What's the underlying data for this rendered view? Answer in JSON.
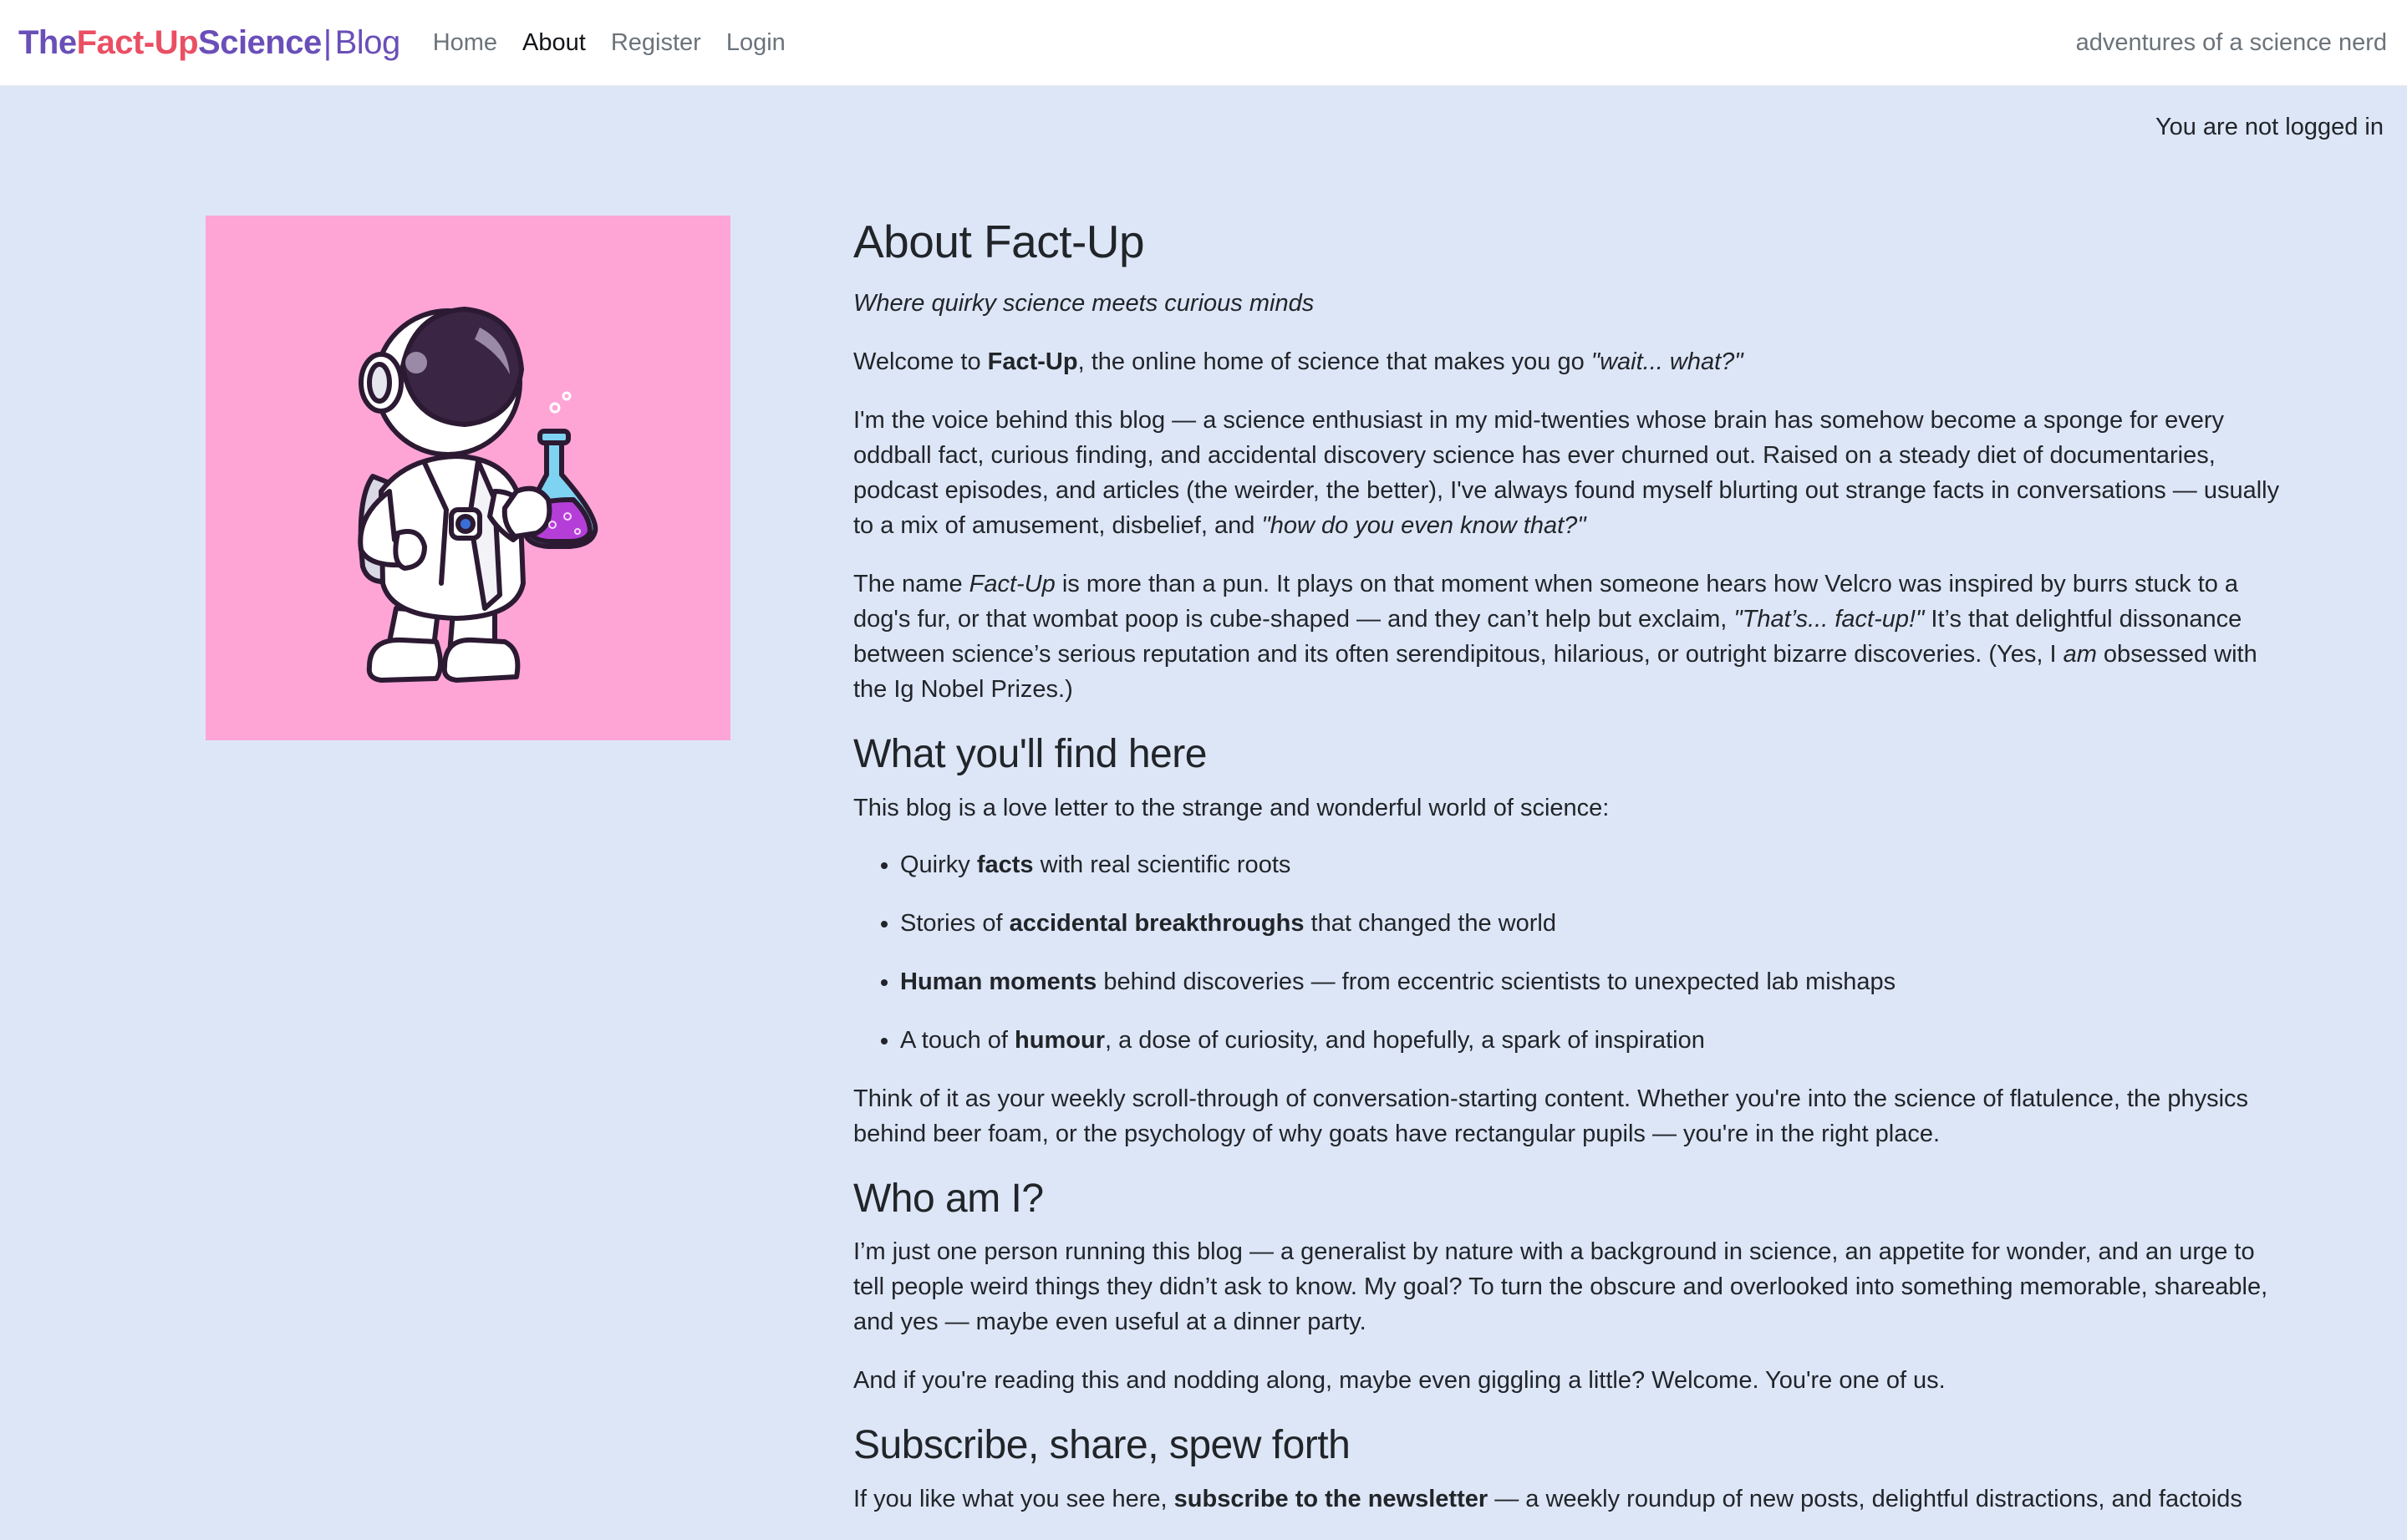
{
  "nav": {
    "brand": {
      "the": "The",
      "fact_up": "Fact-Up",
      "science": "Science",
      "separator": "|",
      "blog": "Blog"
    },
    "links": [
      "Home",
      "About",
      "Register",
      "Login"
    ],
    "active": "About",
    "tagline": "adventures of a science nerd"
  },
  "login_status": "You are not logged in",
  "hero_image": {
    "icon": "astronaut-scientist-icon",
    "background": "#fea5d6"
  },
  "colors": {
    "page_background": "#dde6f7",
    "brand_purple": "#6a4fb8",
    "brand_red": "#ea4f63"
  },
  "about": {
    "title": "About Fact-Up",
    "subtitle": "Where quirky science meets curious minds",
    "welcome": {
      "prefix": "Welcome to ",
      "name": "Fact-Up",
      "middle": ", the online home of science that makes you go ",
      "quote": "\"wait... what?\""
    },
    "intro": {
      "text": "I'm the voice behind this blog — a science enthusiast in my mid-twenties whose brain has somehow become a sponge for every oddball fact, curious finding, and accidental discovery science has ever churned out. Raised on a steady diet of documentaries, podcast episodes, and articles (the weirder, the better), I've always found myself blurting out strange facts in conversations — usually to a mix of amusement, disbelief, and ",
      "quote": "\"how do you even know that?\""
    },
    "name_para": {
      "p1": "The name ",
      "name": "Fact-Up",
      "p2": " is more than a pun. It plays on that moment when someone hears how Velcro was inspired by burrs stuck to a dog's fur, or that wombat poop is cube-shaped — and they can’t help but exclaim, ",
      "quote": "\"That’s... fact-up!\"",
      "p3": " It’s that delightful dissonance between science’s serious reputation and its often serendipitous, hilarious, or outright bizarre discoveries. (Yes, I ",
      "am": "am",
      "p4": " obsessed with the Ig Nobel Prizes.)"
    }
  },
  "find": {
    "heading": "What you'll find here",
    "intro": "This blog is a love letter to the strange and wonderful world of science:",
    "items": [
      {
        "pre": "Quirky ",
        "bold": "facts",
        "post": " with real scientific roots"
      },
      {
        "pre": "Stories of ",
        "bold": "accidental breakthroughs",
        "post": " that changed the world"
      },
      {
        "pre": "",
        "bold": "Human moments",
        "post": " behind discoveries — from eccentric scientists to unexpected lab mishaps"
      },
      {
        "pre": "A touch of ",
        "bold": "humour",
        "post": ", a dose of curiosity, and hopefully, a spark of inspiration"
      }
    ],
    "outro": "Think of it as your weekly scroll-through of conversation-starting content. Whether you're into the science of flatulence, the physics behind beer foam, or the psychology of why goats have rectangular pupils — you're in the right place."
  },
  "who": {
    "heading": "Who am I?",
    "p1": "I’m just one person running this blog — a generalist by nature with a background in science, an appetite for wonder, and an urge to tell people weird things they didn’t ask to know. My goal? To turn the obscure and overlooked into something memorable, shareable, and yes — maybe even useful at a dinner party.",
    "p2": "And if you're reading this and nodding along, maybe even giggling a little? Welcome. You're one of us."
  },
  "subscribe": {
    "heading": "Subscribe, share, spew forth",
    "pre": "If you like what you see here, ",
    "bold": "subscribe to the newsletter",
    "post": " — a weekly roundup of new posts, delightful distractions, and factoids"
  }
}
